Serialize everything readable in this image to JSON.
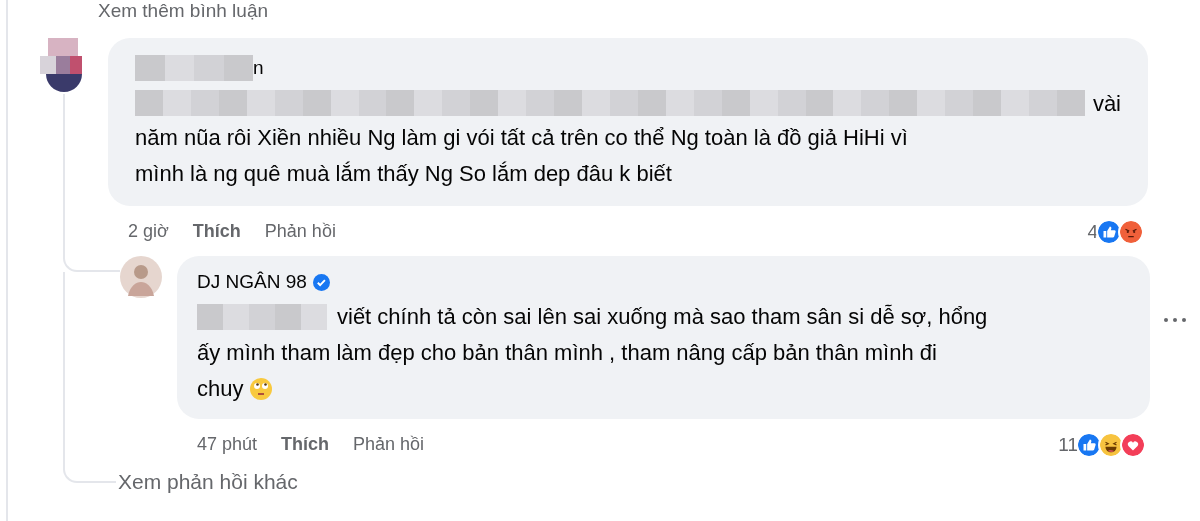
{
  "more_comments_link": "Xem thêm bình luận",
  "comment": {
    "author": "n",
    "text_lines": [
      "vài",
      "năm nũa rôi Xiền nhiều Ng làm gi vói tất cả trên co thể Ng toàn là đồ giả HiHi vì",
      "mình là ng quê muà lắm thấy Ng So lắm dep đâu k biết"
    ],
    "time": "2 giờ",
    "actions": [
      "Thích",
      "Phản hồi"
    ],
    "reaction_count": "4",
    "reactions": [
      {
        "kind": "like"
      },
      {
        "kind": "angry"
      }
    ],
    "reply": {
      "author": "DJ NGÂN 98",
      "verified": true,
      "text_lines": [
        "viết chính tả còn sai lên sai xuống mà sao tham sân si dễ sợ, hổng",
        "ấy mình tham làm đẹp cho bản thân mình , tham nâng cấp bản thân mình đi",
        "chuy"
      ],
      "time": "47 phút",
      "actions": [
        "Thích",
        "Phản hồi"
      ],
      "reaction_count": "11",
      "reactions": [
        {
          "kind": "like"
        },
        {
          "kind": "haha"
        },
        {
          "kind": "love"
        }
      ]
    }
  },
  "more_replies_link": "Xem phản hồi khác"
}
